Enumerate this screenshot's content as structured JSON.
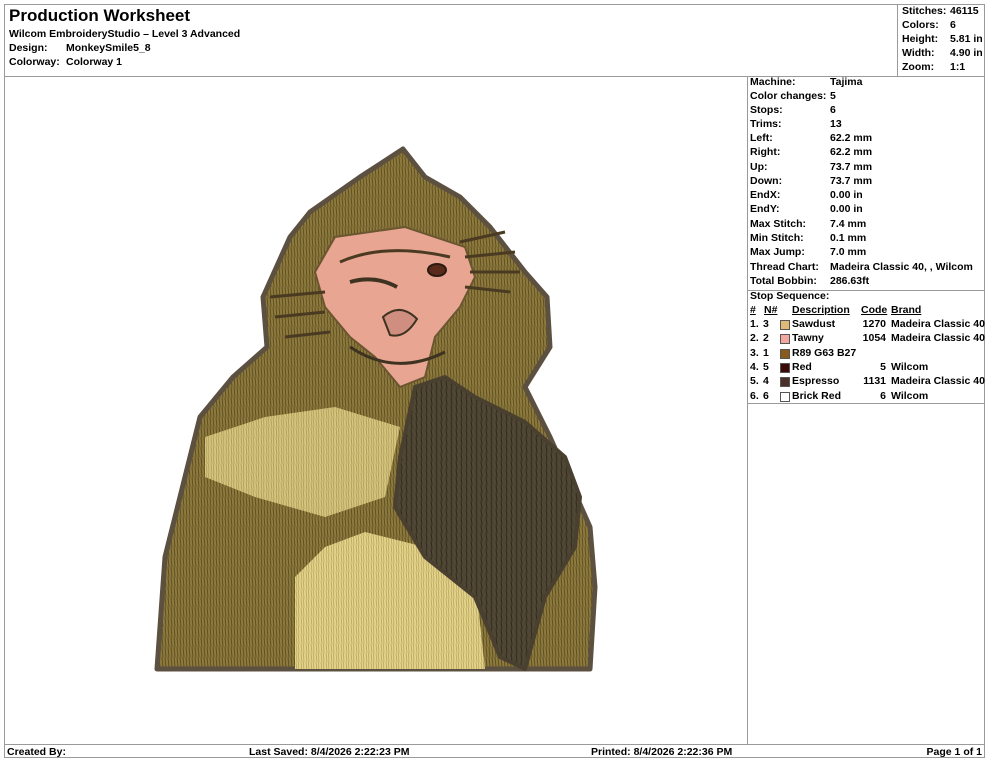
{
  "header": {
    "title": "Production Worksheet",
    "software": "Wilcom EmbroideryStudio – Level 3 Advanced",
    "design_label": "Design:",
    "design_value": "MonkeySmile5_8",
    "colorway_label": "Colorway:",
    "colorway_value": "Colorway 1"
  },
  "stats": [
    {
      "label": "Stitches:",
      "value": "46115"
    },
    {
      "label": "Colors:",
      "value": "6"
    },
    {
      "label": "Height:",
      "value": "5.81 in"
    },
    {
      "label": "Width:",
      "value": "4.90 in"
    },
    {
      "label": "Zoom:",
      "value": "1:1"
    }
  ],
  "machine_info": [
    {
      "label": "Machine:",
      "value": "Tajima"
    },
    {
      "label": "Color changes:",
      "value": "5"
    },
    {
      "label": "Stops:",
      "value": "6"
    },
    {
      "label": "Trims:",
      "value": "13"
    },
    {
      "label": "Left:",
      "value": "62.2 mm"
    },
    {
      "label": "Right:",
      "value": "62.2 mm"
    },
    {
      "label": "Up:",
      "value": "73.7 mm"
    },
    {
      "label": "Down:",
      "value": "73.7 mm"
    },
    {
      "label": "EndX:",
      "value": "0.00 in"
    },
    {
      "label": "EndY:",
      "value": "0.00 in"
    },
    {
      "label": "Max Stitch:",
      "value": "7.4 mm"
    },
    {
      "label": "Min Stitch:",
      "value": "0.1 mm"
    },
    {
      "label": "Max Jump:",
      "value": "7.0 mm"
    },
    {
      "label": "Thread Chart:",
      "value": "Madeira Classic 40, , Wilcom"
    },
    {
      "label": "Total Bobbin:",
      "value": "286.63ft"
    }
  ],
  "stop_sequence": {
    "title": "Stop Sequence:",
    "headers": {
      "num": "#",
      "n": "N#",
      "desc": "Description",
      "code": "Code",
      "brand": "Brand"
    },
    "rows": [
      {
        "num": "1.",
        "n": "3",
        "color": "#e0b878",
        "desc": "Sawdust",
        "code": "1270",
        "brand": "Madeira Classic 40"
      },
      {
        "num": "2.",
        "n": "2",
        "color": "#f2a8a0",
        "desc": "Tawny",
        "code": "1054",
        "brand": "Madeira Classic 40"
      },
      {
        "num": "3.",
        "n": "1",
        "color": "#8a5a1c",
        "desc": "R89 G63 B27",
        "code": "",
        "brand": ""
      },
      {
        "num": "4.",
        "n": "5",
        "color": "#3a0a08",
        "desc": "Red",
        "code": "5",
        "brand": "Wilcom"
      },
      {
        "num": "5.",
        "n": "4",
        "color": "#4a3028",
        "desc": "Espresso",
        "code": "1131",
        "brand": "Madeira Classic 40"
      },
      {
        "num": "6.",
        "n": "6",
        "color": "#ffffff",
        "desc": "Brick Red",
        "code": "6",
        "brand": "Wilcom"
      }
    ]
  },
  "footer": {
    "created_by": "Created By:",
    "last_saved": "Last Saved: 8/4/2026 2:22:23 PM",
    "printed": "Printed: 8/4/2026 2:22:36 PM",
    "page": "Page 1 of 1"
  }
}
